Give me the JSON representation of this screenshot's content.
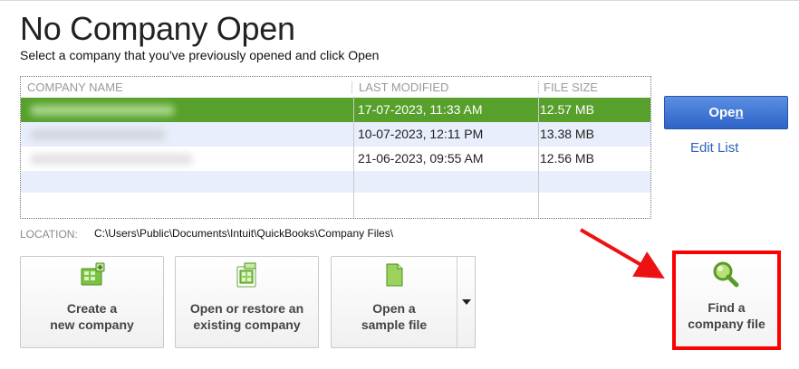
{
  "header": {
    "title": "No Company Open",
    "subtitle": "Select a company that you've previously opened and click Open"
  },
  "table": {
    "columns": [
      "COMPANY NAME",
      "LAST MODIFIED",
      "FILE SIZE"
    ],
    "rows": [
      {
        "name": "",
        "modified": "17-07-2023, 11:33 AM",
        "size": "12.57 MB",
        "selected": true
      },
      {
        "name": "",
        "modified": "10-07-2023, 12:11 PM",
        "size": "13.38 MB",
        "selected": false
      },
      {
        "name": "",
        "modified": "21-06-2023, 09:55 AM",
        "size": "12.56 MB",
        "selected": false
      }
    ]
  },
  "actions": {
    "open_label": "Open",
    "open_mnemonic": "n",
    "edit_list_label": "Edit List"
  },
  "location": {
    "label": "LOCATION:",
    "path": "C:\\Users\\Public\\Documents\\Intuit\\QuickBooks\\Company Files\\"
  },
  "tiles": [
    {
      "line1": "Create a",
      "line2": "new company",
      "icon": "create-company-icon"
    },
    {
      "line1": "Open or restore an",
      "line2": "existing company",
      "icon": "open-restore-icon"
    },
    {
      "line1": "Open a",
      "line2": "sample file",
      "icon": "sample-file-icon"
    },
    {
      "line1": "Find a",
      "line2": "company file",
      "icon": "magnifier-icon"
    }
  ],
  "colors": {
    "selected_row": "#57a02c",
    "alt_row": "#e8eefb",
    "open_button": "#2e63c8",
    "link": "#2e63b8",
    "highlight": "#ff0000"
  }
}
